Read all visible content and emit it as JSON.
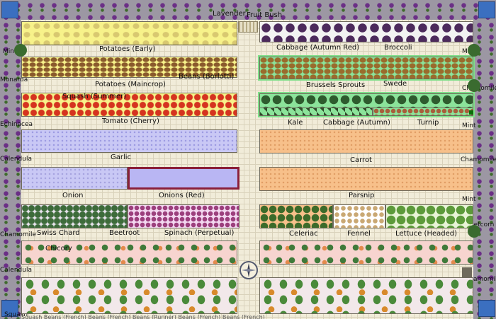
{
  "plan": {
    "top_labels": {
      "lavender": "Lavender",
      "fruit_bush": "Fruit Bush"
    },
    "left_border": [
      "Mint",
      "Monarda",
      "Echinacea",
      "Calendula",
      "Chamomile",
      "Calendula",
      "Squash"
    ],
    "right_border": [
      "Mint",
      "Chamomile",
      "Mint",
      "Chamomile",
      "Mint",
      "Sweetcorn",
      "Chamomile"
    ],
    "left_beds": [
      {
        "name": "Potatoes (Early)"
      },
      {
        "name": "Potatoes (Maincrop)",
        "extra": "Beans (Borlotti)"
      },
      {
        "name": "Tomato (Cherry)",
        "extra": "Squash (Summer)"
      },
      {
        "name": "Garlic"
      },
      {
        "name": "Onion",
        "extra": "Onions (Red)"
      },
      {
        "labels": [
          "Swiss Chard",
          "Beetroot",
          "Spinach (Perpetual)"
        ]
      },
      {
        "name": "Chicory"
      },
      {
        "bottom": "Squash"
      }
    ],
    "right_beds": [
      {
        "labels": [
          "Cabbage (Autumn Red)",
          "Broccoli"
        ]
      },
      {
        "labels": [
          "Brussels Sprouts",
          "Swede"
        ]
      },
      {
        "labels": [
          "Kale",
          "Cabbage (Autumn)",
          "Turnip"
        ]
      },
      {
        "name": "Carrot"
      },
      {
        "name": "Parsnip"
      },
      {
        "labels": [
          "Celeriac",
          "Fennel",
          "Lettuce (Headed)"
        ]
      }
    ],
    "bottom_row": "Squash  Beans (French)  Beans (French)  Beans (Runner)  Beans (French)  Beans (French)"
  }
}
